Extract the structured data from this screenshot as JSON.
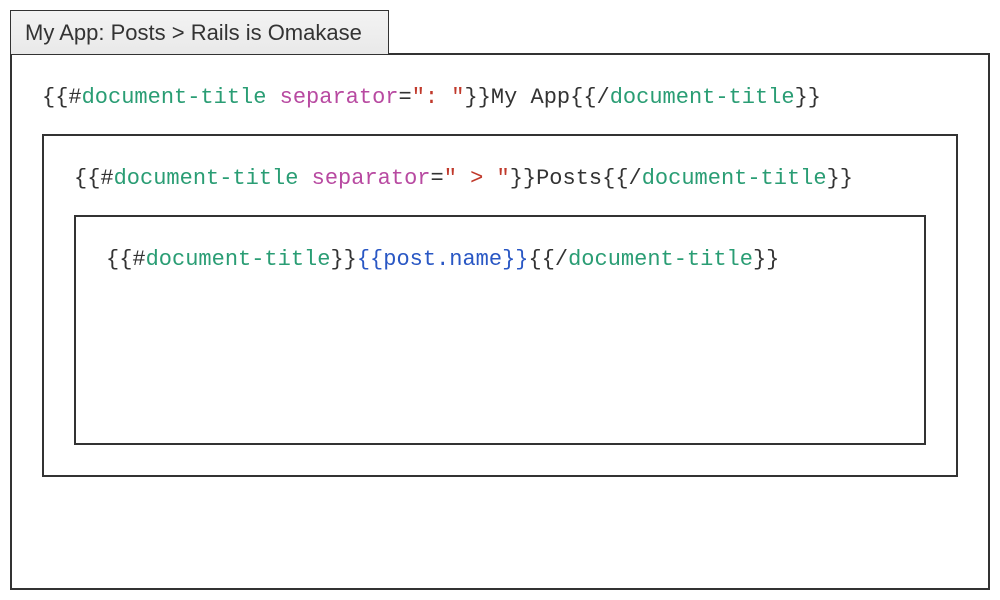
{
  "tab": {
    "title": "My App: Posts > Rails is Omakase"
  },
  "code": {
    "line1": {
      "open_brace": "{{#",
      "tag": "document-title",
      "space": " ",
      "attr": "separator",
      "eq": "=",
      "str": "\": \"",
      "close_open": "}}",
      "content": "My App",
      "close_brace": "{{/",
      "close_tag": "document-title",
      "close_end": "}}"
    },
    "line2": {
      "open_brace": "{{#",
      "tag": "document-title",
      "space": " ",
      "attr": "separator",
      "eq": "=",
      "str": "\" > \"",
      "close_open": "}}",
      "content": "Posts",
      "close_brace": "{{/",
      "close_tag": "document-title",
      "close_end": "}}"
    },
    "line3": {
      "open_brace": "{{#",
      "tag": "document-title",
      "close_open": "}}",
      "expr_open": "{{",
      "expr": "post.name",
      "expr_close": "}}",
      "close_brace": "{{/",
      "close_tag": "document-title",
      "close_end": "}}"
    }
  }
}
